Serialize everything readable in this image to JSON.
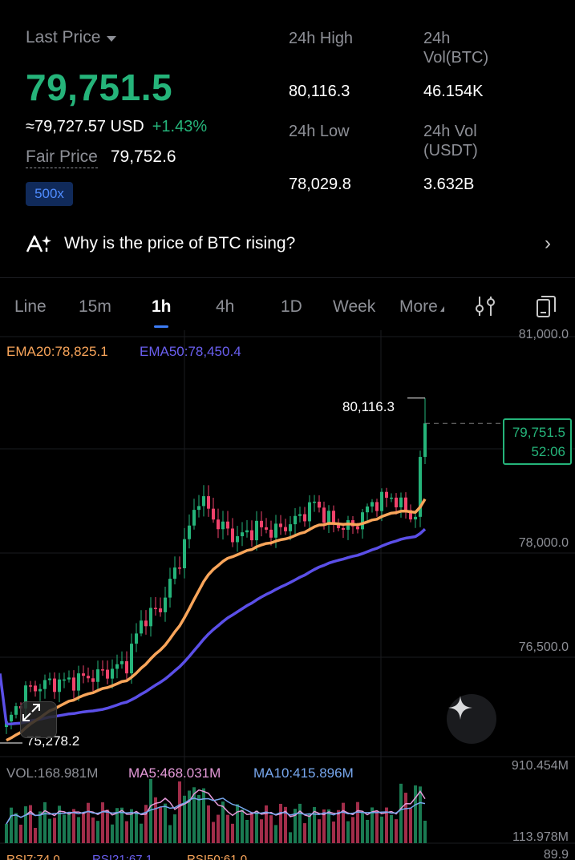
{
  "header": {
    "last_price_label": "Last Price",
    "last_price": "79,751.5",
    "approx_usd": "≈79,727.57 USD",
    "change_pct": "+1.43%",
    "fair_price_label": "Fair Price",
    "fair_price": "79,752.6",
    "leverage_badge": "500x",
    "high_24h_label": "24h High",
    "high_24h": "80,116.3",
    "low_24h_label": "24h Low",
    "low_24h": "78,029.8",
    "vol_btc_label": "24h Vol(BTC)",
    "vol_btc": "46.154K",
    "vol_usdt_label": "24h Vol (USDT)",
    "vol_usdt": "3.632B",
    "why_text": "Why is the price of BTC rising?"
  },
  "tabs": [
    {
      "label": "Line"
    },
    {
      "label": "15m"
    },
    {
      "label": "1h",
      "active": true
    },
    {
      "label": "4h"
    },
    {
      "label": "1D"
    },
    {
      "label": "Week"
    },
    {
      "label": "More"
    }
  ],
  "icons": {
    "why": "ai-sparkle-icon",
    "chevron": "chevron-right-icon",
    "indicators": "sliders-icon",
    "copy": "phone-copy-icon",
    "expand": "expand-icon",
    "assistant": "sparkle-icon"
  },
  "chart": {
    "ema20_label": "EMA20:78,825.1",
    "ema50_label": "EMA50:78,450.4",
    "axis_labels": [
      "81,000.0",
      "78,000.0",
      "76,500.0"
    ],
    "high_marker": "80,116.3",
    "low_marker": "75,278.2",
    "current_price_tag": "79,751.5",
    "countdown": "52:06",
    "vol_label": "VOL:168.981M",
    "ma5_label": "MA5:468.031M",
    "ma10_label": "MA10:415.896M",
    "vol_axis_top": "910.454M",
    "vol_axis_bottom": "113.978M",
    "rsi_axis": "89.9",
    "rsi_labels": [
      "RSI7:74.0",
      "RSI21:67.1",
      "RSI50:61.0"
    ]
  },
  "colors": {
    "up": "#25b47a",
    "down": "#f0426b",
    "ema20": "#f9a55a",
    "ema50": "#5b4fe8",
    "ma5": "#e59ad9",
    "ma10": "#77a7ee",
    "accent": "#3d7cf5"
  },
  "chart_data": {
    "type": "candlestick",
    "interval": "1h",
    "price_axis_ticks": [
      81000,
      78000,
      76500
    ],
    "high": 80116.3,
    "low": 75278.2,
    "last": 79751.5,
    "ema20_last": 78825.1,
    "ema50_last": 78450.4,
    "volume_last": "168.981M",
    "ma5_last": "468.031M",
    "ma10_last": "415.896M"
  }
}
